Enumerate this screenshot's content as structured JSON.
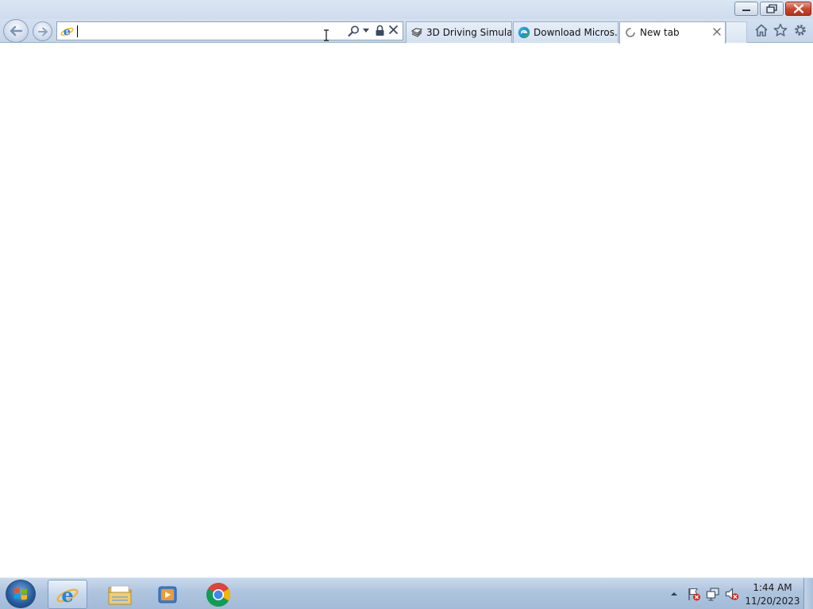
{
  "window": {
    "caption_buttons": [
      "minimize",
      "restore",
      "close"
    ]
  },
  "address_bar": {
    "value": "",
    "placeholder": ""
  },
  "tabs": [
    {
      "label": "3D Driving Simula...",
      "icon": "page-stack-icon",
      "active": false
    },
    {
      "label": "Download Micros...",
      "icon": "edge-logo-icon",
      "active": false
    },
    {
      "label": "New tab",
      "icon": "loading-icon",
      "active": true
    }
  ],
  "toolbar_icons": [
    "home-icon",
    "favorites-star-icon",
    "settings-gear-icon"
  ],
  "taskbar": {
    "pinned": [
      "internet-explorer-icon",
      "file-explorer-icon",
      "media-player-icon",
      "chrome-icon"
    ],
    "active_app": "internet-explorer-icon"
  },
  "tray": {
    "icons": [
      "show-hidden-icons-arrow",
      "action-center-flag-icon",
      "network-icon",
      "volume-muted-icon"
    ],
    "time": "1:44 AM",
    "date": "11/20/2023"
  },
  "colors": {
    "accent": "#1e6fc8",
    "close_red": "#c7432b",
    "chrome_frame": "#cfdced"
  }
}
